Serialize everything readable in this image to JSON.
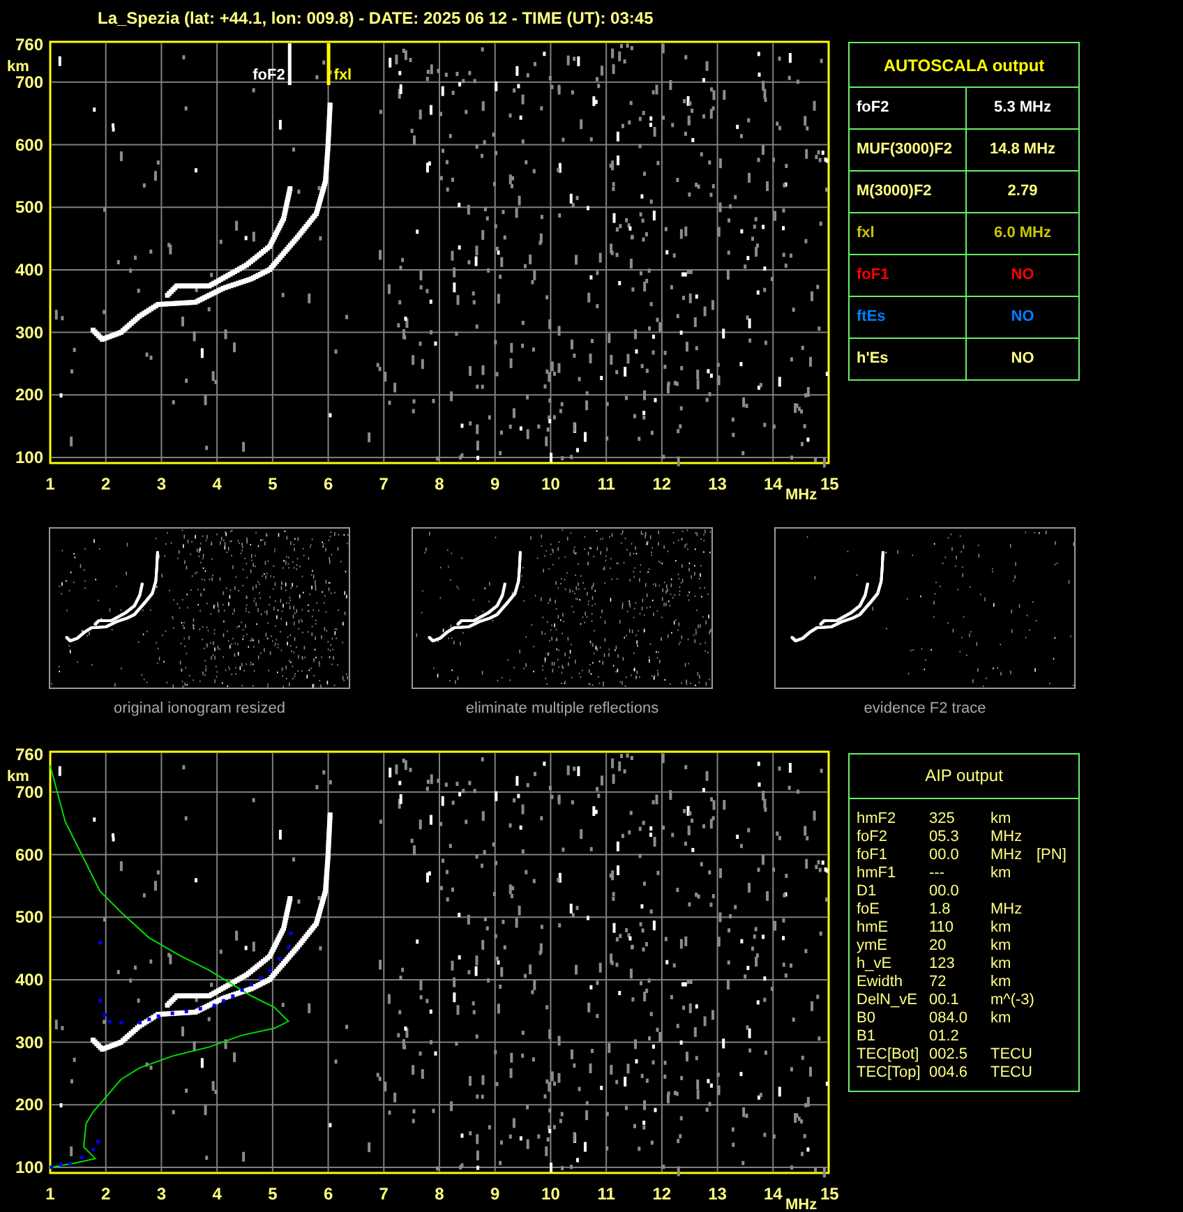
{
  "title": "La_Spezia (lat: +44.1, lon: 009.8) - DATE: 2025 06 12 - TIME (UT): 03:45",
  "ionogram": {
    "y_unit": "km",
    "x_unit": "MHz",
    "yticks": [
      "760",
      "700",
      "600",
      "500",
      "400",
      "300",
      "200",
      "100"
    ],
    "xticks": [
      "1",
      "2",
      "3",
      "4",
      "5",
      "6",
      "7",
      "8",
      "9",
      "10",
      "11",
      "12",
      "13",
      "14",
      "15"
    ],
    "markers": [
      {
        "label": "foF2",
        "kind": "fof2"
      },
      {
        "label": "fxl",
        "kind": "fxl"
      }
    ]
  },
  "autoscala": {
    "title": "AUTOSCALA output",
    "rows": [
      {
        "label": "foF2",
        "value": "5.3 MHz",
        "color": "#ffffff"
      },
      {
        "label": "MUF(3000)F2",
        "value": "14.8 MHz",
        "color": "#ffff80"
      },
      {
        "label": "M(3000)F2",
        "value": "2.79",
        "color": "#ffff80"
      },
      {
        "label": "fxl",
        "value": "6.0 MHz",
        "color": "#c8c800"
      },
      {
        "label": "foF1",
        "value": "NO",
        "color": "#ff0000"
      },
      {
        "label": "ftEs",
        "value": "NO",
        "color": "#0080ff"
      },
      {
        "label": "h'Es",
        "value": "NO",
        "color": "#ffff80"
      }
    ]
  },
  "thumbnails": [
    {
      "caption": "original ionogram resized",
      "kind": "original"
    },
    {
      "caption": "eliminate multiple reflections",
      "kind": "filtered"
    },
    {
      "caption": "evidence F2 trace",
      "kind": "trace"
    }
  ],
  "aip_ionogram": {
    "y_unit": "km",
    "x_unit": "MHz",
    "yticks": [
      "760",
      "700",
      "600",
      "500",
      "400",
      "300",
      "200",
      "100"
    ],
    "xticks": [
      "1",
      "2",
      "3",
      "4",
      "5",
      "6",
      "7",
      "8",
      "9",
      "10",
      "11",
      "12",
      "13",
      "14",
      "15"
    ]
  },
  "aip": {
    "title": "AIP output",
    "rows": [
      {
        "name": "hmF2",
        "value": "325",
        "unit": "km"
      },
      {
        "name": "foF2",
        "value": "05.3",
        "unit": "MHz"
      },
      {
        "name": "foF1",
        "value": "00.0",
        "unit": "MHz",
        "note": "[PN]"
      },
      {
        "name": "hmF1",
        "value": "---",
        "unit": "km"
      },
      {
        "name": "D1",
        "value": "00.0"
      },
      {
        "name": "foE",
        "value": "1.8",
        "unit": "MHz"
      },
      {
        "name": "hmE",
        "value": "110",
        "unit": "km"
      },
      {
        "name": "ymE",
        "value": "20",
        "unit": "km"
      },
      {
        "name": "h_vE",
        "value": "123",
        "unit": "km"
      },
      {
        "name": "Ewidth",
        "value": "72",
        "unit": "km"
      },
      {
        "name": "DelN_vE",
        "value": "00.1",
        "unit": "m^(-3)"
      },
      {
        "name": "B0",
        "value": "084.0",
        "unit": "km"
      },
      {
        "name": "B1",
        "value": "01.2"
      },
      {
        "name": "TEC[Bot]",
        "value": "002.5",
        "unit": "TECU"
      },
      {
        "name": "TEC[Top]",
        "value": "004.6",
        "unit": "TECU"
      }
    ]
  }
}
